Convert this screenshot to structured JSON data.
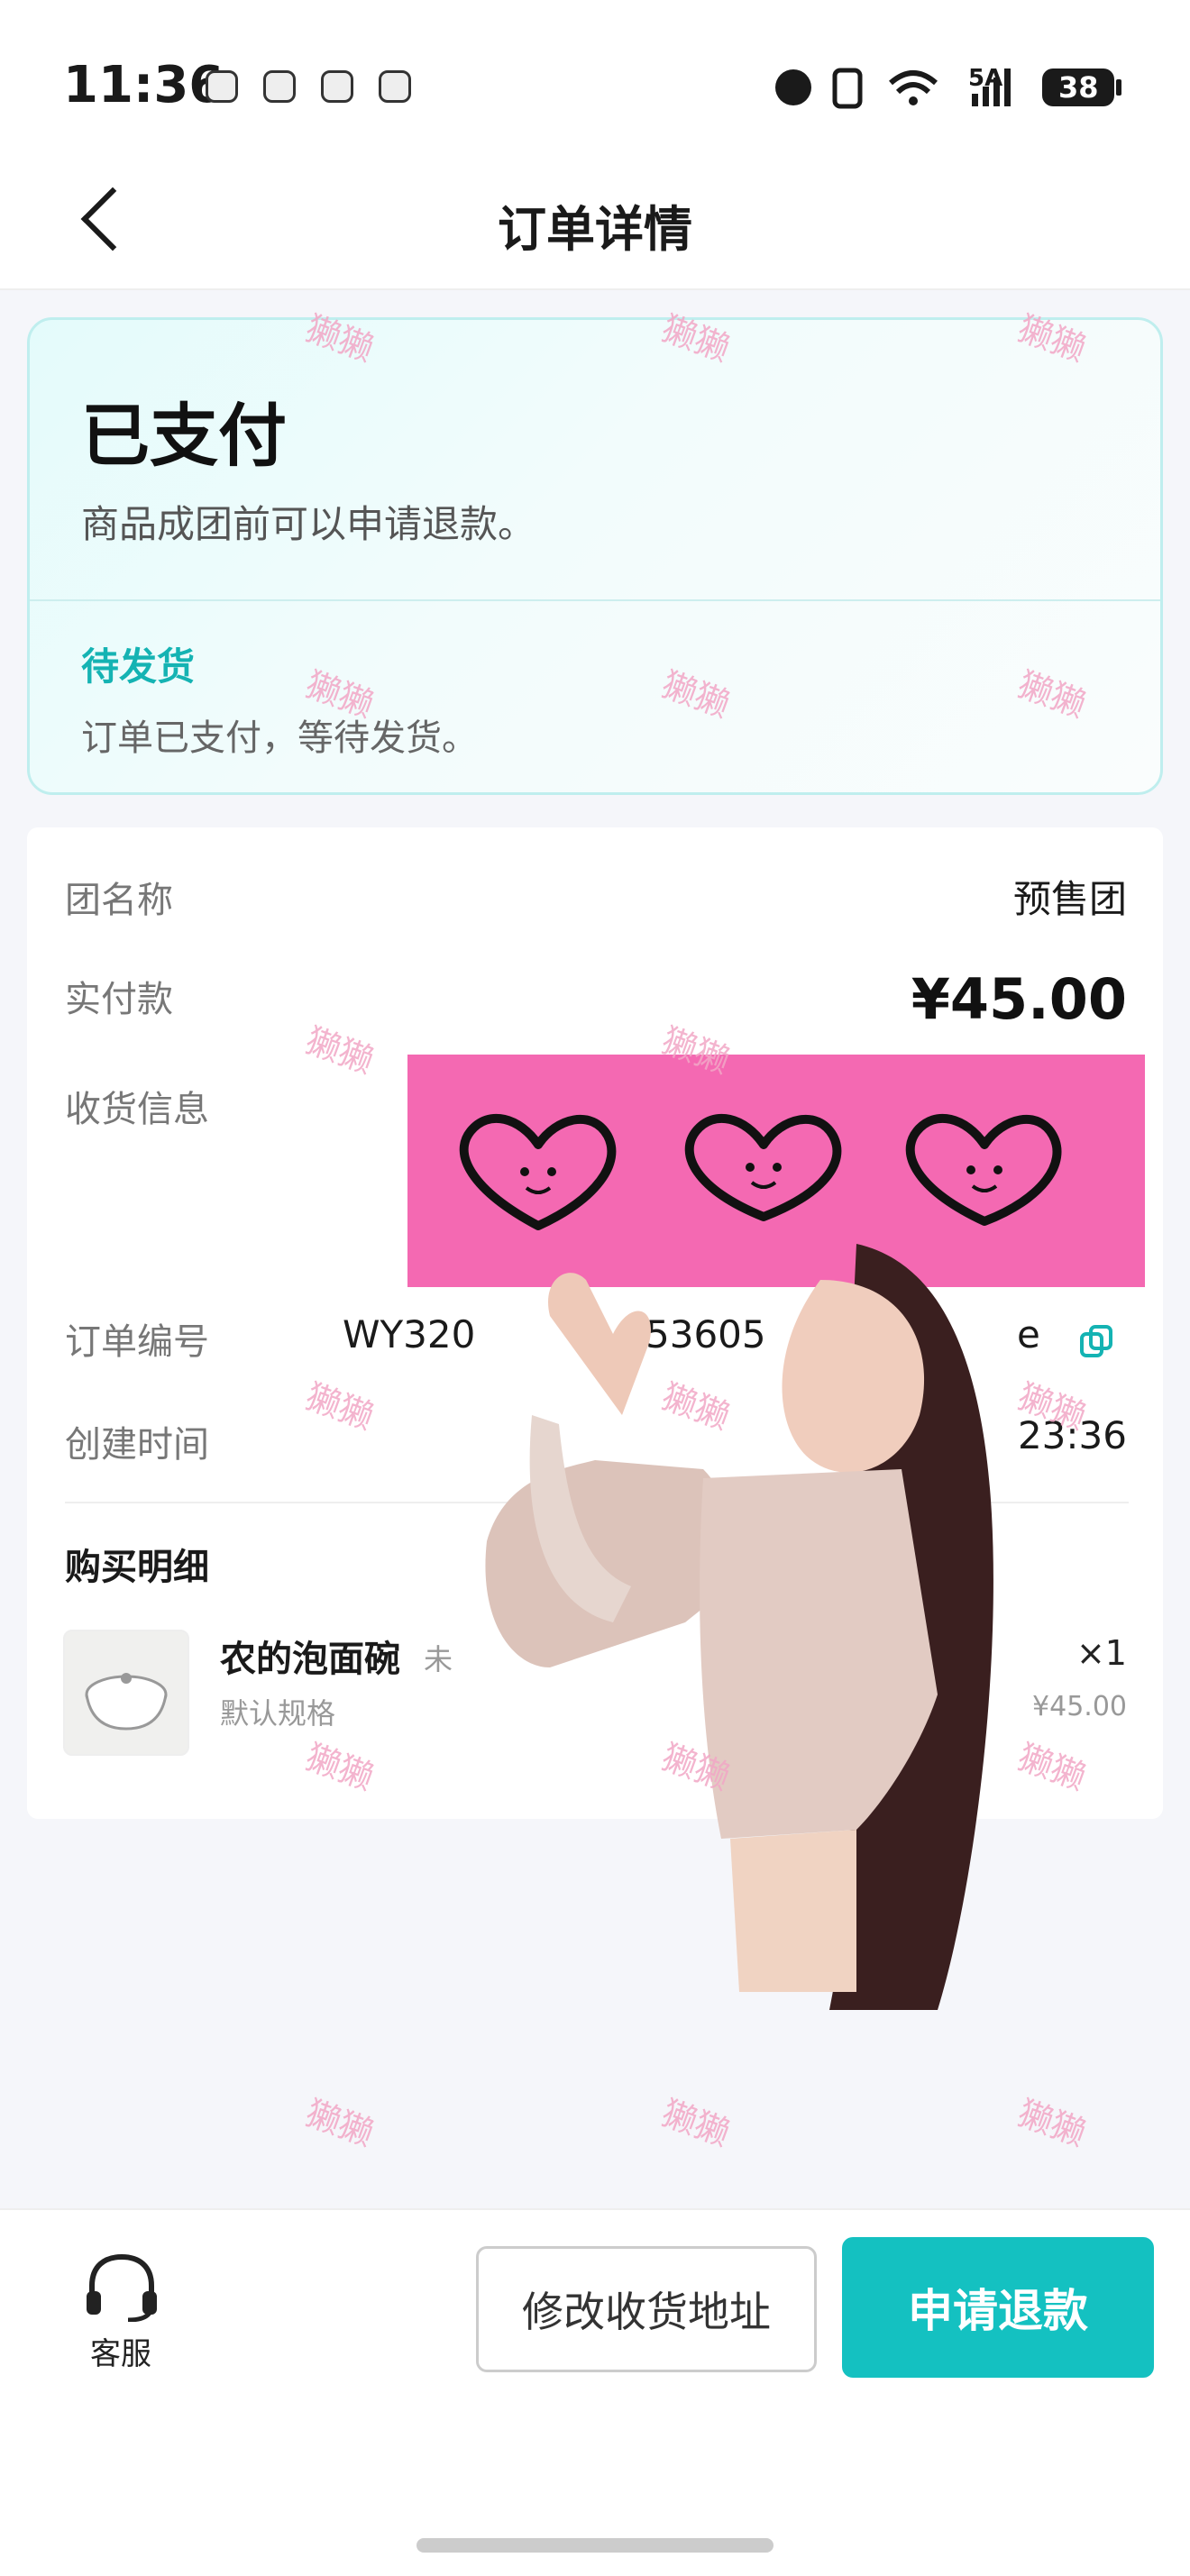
{
  "status_bar": {
    "time": "11:36",
    "network": "5A",
    "battery": "38"
  },
  "header": {
    "title": "订单详情"
  },
  "order_status": {
    "title": "已支付",
    "description": "商品成团前可以申请退款。",
    "sub_status": "待发货",
    "sub_description": "订单已支付，等待发货。"
  },
  "order_info": {
    "group_name_label": "团名称",
    "group_name_value": "预售团",
    "paid_label": "实付款",
    "paid_value": "¥45.00",
    "address_label": "收货信息",
    "order_no_label": "订单编号",
    "order_no_visible_start": "WY320",
    "order_no_visible_mid": "53605",
    "order_no_visible_end": "e",
    "created_label": "创建时间",
    "created_value_visible": "23:36"
  },
  "purchase": {
    "section_title": "购买明细",
    "item_name": "农的泡面碗",
    "item_badge": "未",
    "item_spec": "默认规格",
    "item_qty": "×1",
    "item_price": "¥45.00"
  },
  "watermark": "獭獭",
  "bottom_bar": {
    "customer_service": "客服",
    "change_address": "修改收货地址",
    "refund": "申请退款"
  },
  "colors": {
    "accent": "#14c1c1",
    "sticker_pink": "#f469b2",
    "sub_status": "#15b3b3"
  }
}
